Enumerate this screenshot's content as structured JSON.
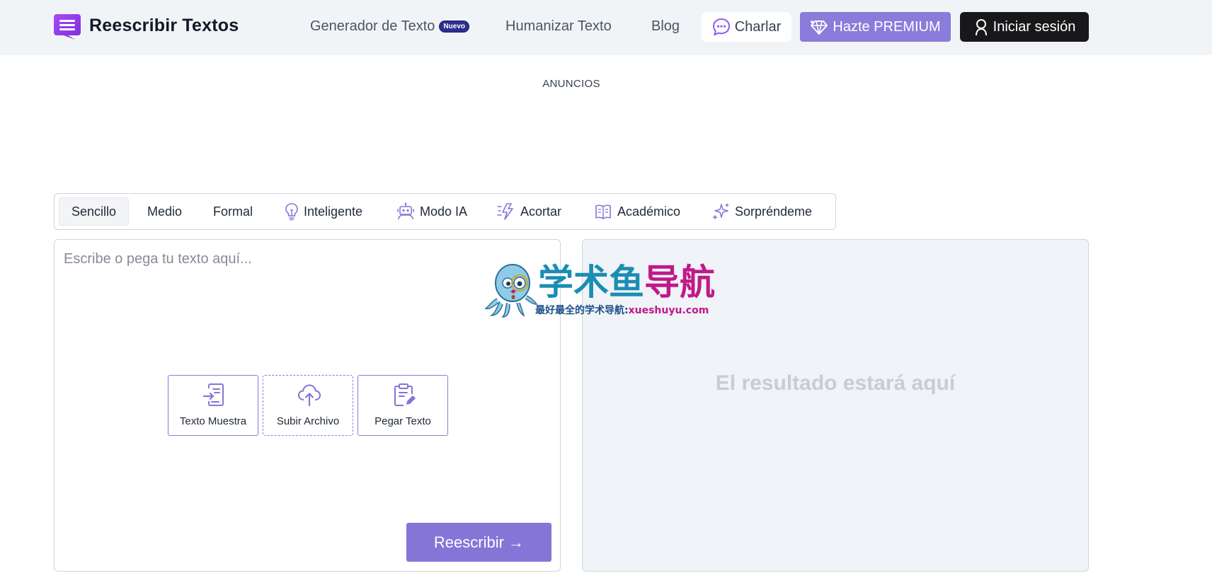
{
  "header": {
    "logo_text": "Reescribir Textos",
    "nav": [
      {
        "label": "Generador de Texto",
        "badge": "Nuevo"
      },
      {
        "label": "Humanizar Texto"
      },
      {
        "label": "Blog"
      }
    ],
    "chat_label": "Charlar",
    "premium_label": "Hazte PREMIUM",
    "login_label": "Iniciar sesión"
  },
  "ads_label": "ANUNCIOS",
  "modes": [
    {
      "label": "Sencillo",
      "icon": "none",
      "active": true
    },
    {
      "label": "Medio",
      "icon": "none"
    },
    {
      "label": "Formal",
      "icon": "none"
    },
    {
      "label": "Inteligente",
      "icon": "lightbulb-icon"
    },
    {
      "label": "Modo IA",
      "icon": "robot-icon"
    },
    {
      "label": "Acortar",
      "icon": "lightning-icon"
    },
    {
      "label": "Académico",
      "icon": "book-icon"
    },
    {
      "label": "Sorpréndeme",
      "icon": "sparkles-icon"
    }
  ],
  "input": {
    "placeholder": "Escribe o pega tu texto aquí...",
    "value": "",
    "actions": [
      {
        "label": "Texto Muestra",
        "icon": "sample-text-icon"
      },
      {
        "label": "Subir Archivo",
        "icon": "upload-cloud-icon"
      },
      {
        "label": "Pegar Texto",
        "icon": "paste-clipboard-icon"
      }
    ],
    "rewrite_label": "Reescribir →"
  },
  "output": {
    "placeholder": "El resultado estará aquí"
  },
  "watermark": {
    "title_a": "学术鱼",
    "title_b": "导航",
    "subtitle_a": "最好最全的学术导航:",
    "subtitle_b": "xueshuyu.com"
  },
  "colors": {
    "accent": "#8575d7",
    "header_bg": "#f1f4f7",
    "login_bg": "#18181b",
    "output_bg": "#f0f3f7"
  }
}
